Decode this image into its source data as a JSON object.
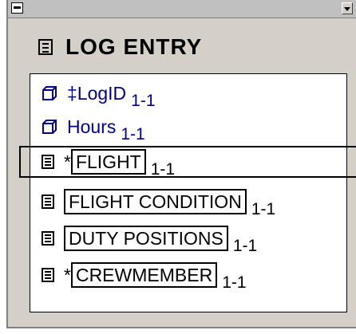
{
  "window": {
    "title": "LOG ENTRY"
  },
  "attributes": [
    {
      "label": "‡LogID",
      "multiplicity": "1-1"
    },
    {
      "label": "Hours",
      "multiplicity": "1-1"
    }
  ],
  "relations": [
    {
      "prefix": "*",
      "label": "FLIGHT",
      "multiplicity": "1-1"
    },
    {
      "prefix": "",
      "label": "FLIGHT CONDITION",
      "multiplicity": "1-1"
    },
    {
      "prefix": "",
      "label": "DUTY POSITIONS",
      "multiplicity": "1-1"
    },
    {
      "prefix": "*",
      "label": "CREWMEMBER",
      "multiplicity": "1-1"
    }
  ]
}
